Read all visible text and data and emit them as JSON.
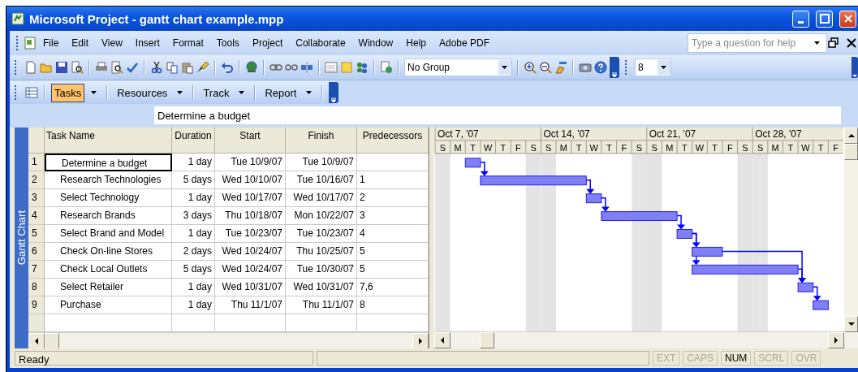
{
  "window": {
    "title": "Microsoft Project - gantt chart example.mpp"
  },
  "menu_bar": {
    "items": [
      "File",
      "Edit",
      "View",
      "Insert",
      "Format",
      "Tools",
      "Project",
      "Collaborate",
      "Window",
      "Help",
      "Adobe PDF"
    ],
    "help_search": {
      "placeholder": "Type a question for help"
    }
  },
  "standard_toolbar": {
    "group_combo": {
      "value": "No Group"
    }
  },
  "formatting_toolbar": {
    "font_size": {
      "value": "8"
    }
  },
  "guide_toolbar": {
    "items": [
      {
        "label": "Tasks",
        "selected": true
      },
      {
        "label": "Resources",
        "selected": false
      },
      {
        "label": "Track",
        "selected": false
      },
      {
        "label": "Report",
        "selected": false
      }
    ]
  },
  "entry_bar": {
    "value": "Determine a budget"
  },
  "view_bar": {
    "label": "Gantt Chart"
  },
  "table": {
    "columns": [
      "Task Name",
      "Duration",
      "Start",
      "Finish",
      "Predecessors"
    ],
    "rows": [
      {
        "id": "1",
        "name": "Determine a budget",
        "duration": "1 day",
        "start": "Tue 10/9/07",
        "finish": "Tue 10/9/07",
        "selected": true
      },
      {
        "id": "2",
        "name": "Research Technologies",
        "duration": "5 days",
        "start": "Wed 10/10/07",
        "finish": "Tue 10/16/07",
        "predecessors": "1",
        "selected": false
      },
      {
        "id": "3",
        "name": "Select Technology",
        "duration": "1 day",
        "start": "Wed 10/17/07",
        "finish": "Wed 10/17/07",
        "predecessors": "2",
        "selected": false
      },
      {
        "id": "4",
        "name": "Research Brands",
        "duration": "3 days",
        "start": "Thu 10/18/07",
        "finish": "Mon 10/22/07",
        "predecessors": "3",
        "selected": false
      },
      {
        "id": "5",
        "name": "Select Brand and Model",
        "duration": "1 day",
        "start": "Tue 10/23/07",
        "finish": "Tue 10/23/07",
        "predecessors": "4",
        "selected": false
      },
      {
        "id": "6",
        "name": "Check On-line Stores",
        "duration": "2 days",
        "start": "Wed 10/24/07",
        "finish": "Thu 10/25/07",
        "predecessors": "5",
        "selected": false
      },
      {
        "id": "7",
        "name": "Check Local Outlets",
        "duration": "5 days",
        "start": "Wed 10/24/07",
        "finish": "Tue 10/30/07",
        "predecessors": "5",
        "selected": false
      },
      {
        "id": "8",
        "name": "Select Retailer",
        "duration": "1 day",
        "start": "Wed 10/31/07",
        "finish": "Wed 10/31/07",
        "predecessors": "7,6",
        "selected": false
      },
      {
        "id": "9",
        "name": "Purchase",
        "duration": "1 day",
        "start": "Thu 11/1/07",
        "finish": "Thu 11/1/07",
        "predecessors": "8",
        "selected": false
      }
    ]
  },
  "gantt": {
    "weeks": [
      "Oct 7, '07",
      "Oct 14, '07",
      "Oct 21, '07",
      "Oct 28, '07"
    ],
    "days": [
      "S",
      "M",
      "T",
      "W",
      "T",
      "F",
      "S",
      "S",
      "M",
      "T",
      "W",
      "T",
      "F",
      "S",
      "S",
      "M",
      "T",
      "W",
      "T",
      "F",
      "S",
      "S",
      "M",
      "T",
      "W",
      "T",
      "F"
    ]
  },
  "status_bar": {
    "status": "Ready",
    "indicators": [
      {
        "label": "EXT",
        "on": false
      },
      {
        "label": "CAPS",
        "on": false
      },
      {
        "label": "NUM",
        "on": true
      },
      {
        "label": "SCRL",
        "on": false
      },
      {
        "label": "OVR",
        "on": false
      }
    ]
  }
}
